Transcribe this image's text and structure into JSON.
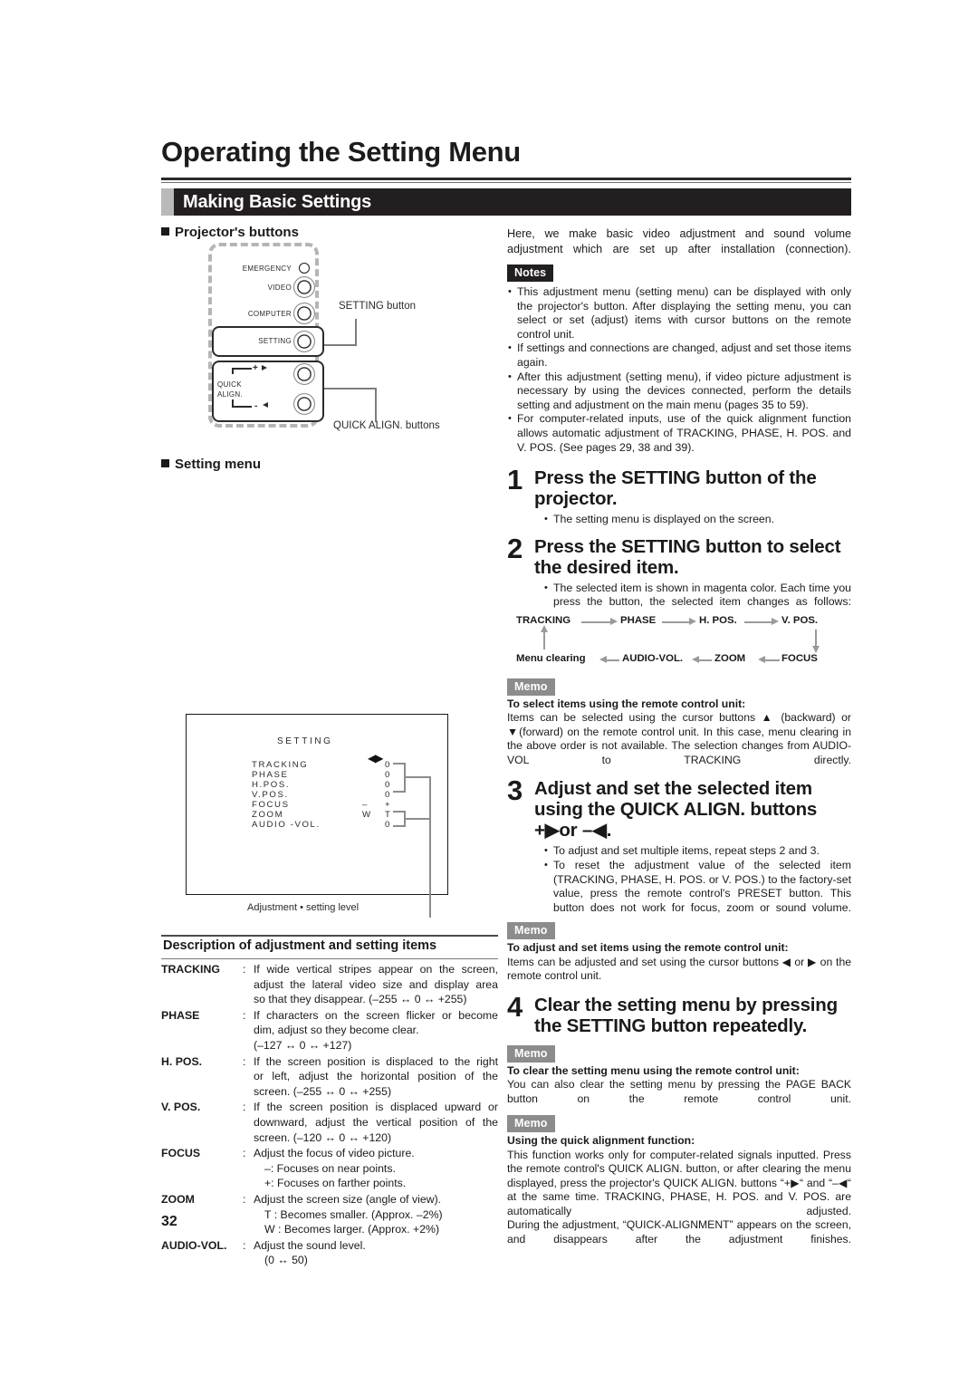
{
  "document": {
    "title": "Operating the Setting Menu",
    "section_title": "Making Basic Settings",
    "page_number": "32"
  },
  "left": {
    "projector_heading": "Projector's buttons",
    "projector_panel": {
      "rows": [
        {
          "label": "EMERGENCY",
          "control": "led"
        },
        {
          "label": "VIDEO",
          "control": "knob"
        },
        {
          "label": "COMPUTER",
          "control": "knob"
        },
        {
          "label": "SETTING",
          "control": "knob"
        }
      ],
      "quick_align_label_line1": "QUICK",
      "quick_align_label_line2": "ALIGN.",
      "quick_align_plus": "+",
      "quick_align_minus": "-"
    },
    "callouts": {
      "setting_button": "SETTING button",
      "quick_align_buttons": "QUICK ALIGN. buttons"
    },
    "setting_menu_heading": "Setting menu",
    "setting_menu": {
      "title": "SETTING",
      "arrows": "◀▶",
      "items": [
        {
          "label": "TRACKING",
          "v1": "",
          "v2": "0"
        },
        {
          "label": "PHASE",
          "v1": "",
          "v2": "0"
        },
        {
          "label": "H.POS.",
          "v1": "",
          "v2": "0"
        },
        {
          "label": "V.POS.",
          "v1": "",
          "v2": "0"
        },
        {
          "label": "FOCUS",
          "v1": "–",
          "v2": "+"
        },
        {
          "label": "ZOOM",
          "v1": "W",
          "v2": "T"
        },
        {
          "label": "AUDIO -VOL.",
          "v1": "",
          "v2": "0"
        }
      ],
      "caption": "Adjustment • setting level"
    },
    "description": {
      "title": "Description of adjustment and setting items",
      "colon": ":",
      "rows": [
        {
          "term": "TRACKING",
          "lines": [
            "If wide vertical stripes appear on the screen,",
            "adjust the lateral video size and display area",
            "so that they disappear. (–255 ↔ 0 ↔ +255)"
          ]
        },
        {
          "term": "PHASE",
          "lines": [
            "If characters on the screen flicker or become",
            "dim, adjust so they become clear.",
            "(–127 ↔ 0 ↔ +127)"
          ]
        },
        {
          "term": "H. POS.",
          "lines": [
            "If the screen position is displaced to the right",
            "or left, adjust the horizontal position of the",
            "screen. (–255 ↔ 0 ↔ +255)"
          ]
        },
        {
          "term": "V. POS.",
          "lines": [
            "If the screen position is displaced upward or",
            "downward, adjust the vertical position of the",
            "screen. (–120 ↔ 0 ↔ +120)"
          ]
        },
        {
          "term": "FOCUS",
          "lines": [
            "Adjust the focus of video picture.",
            "–: Focuses on near points.",
            "+: Focuses on farther points."
          ]
        },
        {
          "term": "ZOOM",
          "lines": [
            "Adjust the screen size (angle of view).",
            "T : Becomes smaller. (Approx. –2%)",
            "W : Becomes larger. (Approx. +2%)"
          ]
        },
        {
          "term": "AUDIO-VOL.",
          "lines": [
            "Adjust the sound level.",
            "(0 ↔ 50)"
          ]
        }
      ]
    }
  },
  "right": {
    "intro": "Here, we make basic video adjustment and sound volume adjustment which are set up after installation (connection).",
    "notes_badge": "Notes",
    "notes": [
      "This adjustment menu (setting menu) can be displayed with only the projector's button. After displaying the setting menu, you can select or set (adjust) items with cursor buttons on the remote control unit.",
      "If settings and connections are changed, adjust and set those items again.",
      "After this adjustment (setting menu), if video picture adjustment is necessary by using the devices connected, perform the details setting and adjustment on the main menu (pages 35 to 59).",
      "For computer-related inputs, use of the quick alignment function allows automatic adjustment of TRACKING, PHASE, H. POS. and V. POS. (See pages 29, 38 and 39)."
    ],
    "steps": [
      {
        "num": "1",
        "heading": "Press the SETTING button of the projector.",
        "bullets": [
          "The setting menu is displayed on the screen."
        ]
      },
      {
        "num": "2",
        "heading": "Press the SETTING button to select the desired item.",
        "bullets": [
          "The selected item is shown in magenta color. Each time you press the button, the selected item changes as follows:"
        ]
      },
      {
        "num": "3",
        "heading": "Adjust and set the selected item using the QUICK ALIGN. buttons +▶or –◀.",
        "bullets": [
          "To adjust and set multiple items, repeat steps 2 and 3.",
          "To reset the adjustment value of the selected item (TRACKING, PHASE, H. POS. or V. POS.) to the factory-set value, press the remote control's PRESET button. This button does not work for focus, zoom or sound volume."
        ]
      },
      {
        "num": "4",
        "heading": "Clear the setting menu by pressing the SETTING button repeatedly.",
        "bullets": []
      }
    ],
    "flow": {
      "top": [
        "TRACKING",
        "PHASE",
        "H. POS.",
        "V. POS."
      ],
      "bottom": [
        "Menu clearing",
        "AUDIO-VOL.",
        "ZOOM",
        "FOCUS"
      ]
    },
    "memos": [
      {
        "badge": "Memo",
        "subtitle": "To select items using the remote control unit:",
        "text": "Items can be selected using the cursor buttons ▲ (backward) or ▼(forward) on the remote control unit. In this case, menu clearing in the above order is not available. The selection changes from AUDIO-VOL to TRACKING directly."
      },
      {
        "badge": "Memo",
        "subtitle": "To adjust and set items using the remote control unit:",
        "text": "Items can be adjusted and set using the cursor buttons ◀ or ▶ on the remote control unit."
      },
      {
        "badge": "Memo",
        "subtitle": "To clear the setting menu using the remote control unit:",
        "text": "You can also clear the setting menu by pressing the PAGE BACK button on the remote control unit."
      },
      {
        "badge": "Memo",
        "subtitle": "Using the quick alignment function:",
        "text": "This function works only for computer-related signals inputted. Press the remote control's QUICK ALIGN. button, or after clearing the menu displayed, press the projector's QUICK ALIGN. buttons “+▶“ and “–◀“ at the same time. TRACKING, PHASE, H. POS. and V. POS. are automatically adjusted.",
        "text2": "During the adjustment, “QUICK-ALIGNMENT” appears on the screen, and disappears after the adjustment finishes."
      }
    ]
  },
  "colors": {
    "section_bar": "#231f20",
    "notes_badge": "#231f20",
    "memo_badge": "#8c8c8c",
    "diagram_gray": "#8c8c8c",
    "dash_gray": "#b5b5b5"
  }
}
